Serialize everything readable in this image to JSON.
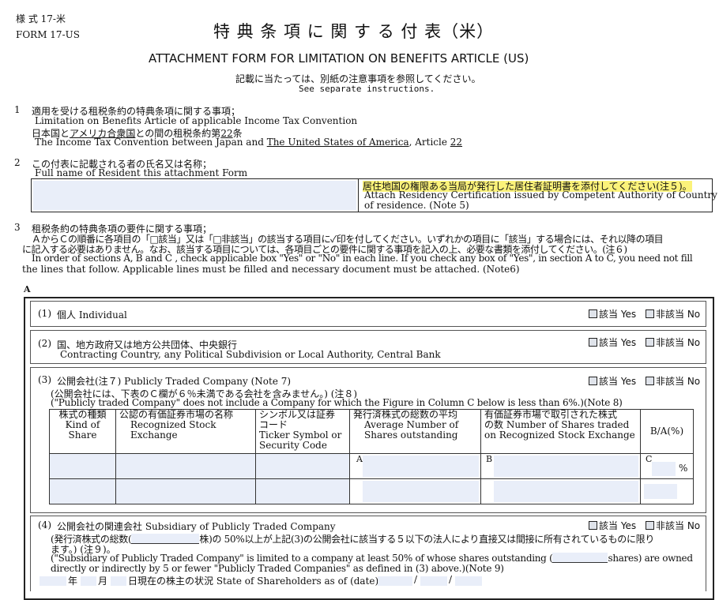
{
  "form": {
    "label_ja": "様 式 17-米",
    "label_en": "FORM 17-US",
    "title_ja": "特 典 条 項 に 関 す る 付 表（米）",
    "title_en": "ATTACHMENT FORM FOR LIMITATION ON BENEFITS ARTICLE (US)",
    "note_ja": "記載に当たっては、別紙の注意事項を参照してください。",
    "note_en": "See separate instructions."
  },
  "s1": {
    "num": "1",
    "ja": "適用を受ける租税条約の特典条項に関する事項；",
    "en": "Limitation on Benefits Article of applicable Income Tax Convention",
    "ja2_a": "日本国と",
    "ja2_country": "アメリカ合衆国",
    "ja2_b": "との間の租税条約第",
    "ja2_article": "22",
    "ja2_c": "条",
    "en2_a": "The Income Tax Convention between Japan and ",
    "en2_country": "The United States of America",
    "en2_b": ", Article ",
    "en2_article": "22"
  },
  "s2": {
    "num": "2",
    "ja": "この付表に記載される者の氏名又は名称；",
    "en": "Full name of Resident this attachment Form",
    "attach_ja": "居住地国の権限ある当局が発行した居住者証明書を添付してください(注５)。",
    "attach_en1": "Attach Residency Certification issued by Competent Authority of Country",
    "attach_en2": "of residence. (Note 5)"
  },
  "s3": {
    "num": "3",
    "ja": "租税条約の特典条項の要件に関する事項；",
    "ja_l1": "ＡからＣの順番に各項目の「□該当」又は「□非該当」の該当する項目に✓印を付してください。いずれかの項目に「該当」する場合には、それ以降の項目",
    "ja_l2": "に記入する必要はありません。なお、該当する項目については、各項目ごとの要件に関する事項を記入の上、必要な書類を添付してください。(注６)",
    "en_l1": "In order of sections A, B and C , check applicable box \"Yes\" or \"No\" in each line. If you check any box of \"Yes\", in section A to C, you need not fill",
    "en_l2": "the lines that follow. Applicable lines must be filled and necessary document must be attached. (Note6)"
  },
  "sectionA": {
    "label": "A",
    "yes": "該当 Yes",
    "no": "非該当 No",
    "i1": {
      "num": "(1)",
      "text": "個人 Individual"
    },
    "i2": {
      "num": "(2)",
      "ja": "国、地方政府又は地方公共団体、中央銀行",
      "en": "Contracting Country, any Political Subdivision or Local Authority, Central Bank"
    },
    "i3": {
      "num": "(3)",
      "text": "公開会社(注７) Publicly Traded Company (Note 7)",
      "note_ja": "(公開会社には、下表のＣ欄が６％未満である会社を含みません。) (注８)",
      "note_en": "(\"Publicly traded Company\" does not include a Company for which the Figure in Column C below is less than 6%.)(Note 8)",
      "table": {
        "h1": [
          "株式の種類",
          "Kind of",
          "Share"
        ],
        "h2": [
          "公認の有価証券市場の名称",
          "Recognized Stock",
          "Exchange"
        ],
        "h3": [
          "シンボル又は証券",
          "コード",
          "Ticker Symbol or",
          "Security Code"
        ],
        "h4": [
          "発行済株式の総数の平均",
          "Average Number of",
          "Shares outstanding"
        ],
        "h5": [
          "有価証券市場で取引された株式",
          "の数  Number of Shares traded",
          "on Recognized Stock Exchange"
        ],
        "h6": "B/A(%)",
        "colA": "A",
        "colB": "B",
        "colC": "C",
        "pct": "%"
      }
    },
    "i4": {
      "num": "(4)",
      "text": "公開会社の関連会社 Subsidiary of Publicly Traded Company",
      "ja1a": "(発行済株式の総数(",
      "ja1b": "株)の  50%以上が上記(3)の公開会社に該当する５以下の法人により直接又は間接に所有されているものに限り",
      "ja2": "ます。) (注９)。",
      "en1a": "(\"Subsidiary of Publicly Traded Company\" is limited to a company at least 50% of whose shares outstanding (",
      "en1b": "shares) are owned",
      "en2": "directly or indirectly by 5 or fewer \"Publicly Traded Companies\" as defined in (3) above.)(Note 9)",
      "date_y": "年",
      "date_m": "月",
      "date_d": "日現在の株主の状況  State of Shareholders as of (date)",
      "slash": "/"
    }
  }
}
